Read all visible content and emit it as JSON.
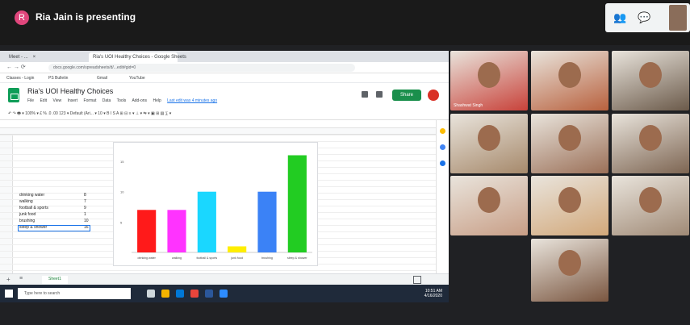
{
  "meet": {
    "presenter_initial": "R",
    "presenting_text": "Ria Jain is presenting",
    "top_right_icons": [
      "people-icon",
      "chat-icon"
    ]
  },
  "browser": {
    "tabs": [
      {
        "label": "Meet - ...",
        "active": false
      },
      {
        "label": "Ria's UOI Healthy Choices - Google Sheets",
        "active": true
      }
    ],
    "url": "docs.google.com/spreadsheets/d/...edit#gid=0",
    "bookmarks": [
      "Classes - Login",
      "PS Bulletin",
      "Gmail",
      "YouTube"
    ]
  },
  "sheet": {
    "title": "Ria's UOI Healthy Choices",
    "menu": [
      "File",
      "Edit",
      "View",
      "Insert",
      "Format",
      "Data",
      "Tools",
      "Add-ons",
      "Help",
      "Last edit was 4 minutes ago"
    ],
    "share_label": "Share",
    "toolbar_text": "↶ ↷ 🖶 ▾ 100% ▾ £ % .0 .00 123 ▾ Default (Ari... ▾ 10 ▾ B I S A ⊞ ⊟ ≡ ▾ ⊥ ▾ ⇆ ▾ ▣ ⊞ ▤ ∑ ▾",
    "sheet_tab_label": "Sheet1",
    "rows": [
      {
        "label": "drinking water",
        "value": "8"
      },
      {
        "label": "walking",
        "value": "7"
      },
      {
        "label": "football & sports",
        "value": "9"
      },
      {
        "label": "junk food",
        "value": "1"
      },
      {
        "label": "brushing",
        "value": "10"
      },
      {
        "label": "sleep & shower",
        "value": "16"
      }
    ]
  },
  "chart_data": {
    "type": "bar",
    "categories": [
      "drinking water",
      "walking",
      "football & sports",
      "junk food",
      "brushing",
      "sleep & shower"
    ],
    "values": [
      7,
      7,
      10,
      1,
      10,
      16
    ],
    "colors": [
      "#ff1a1a",
      "#ff33ff",
      "#1ad7ff",
      "#ffee00",
      "#3b82f6",
      "#22cc22"
    ],
    "ylim": [
      0,
      17
    ],
    "y_ticks": [
      "15",
      "10",
      "5"
    ],
    "grid": false
  },
  "taskbar": {
    "search_placeholder": "Type here to search",
    "time": "10:51 AM",
    "date": "4/16/2020"
  },
  "participants": [
    {
      "name": "Shashwat Singh",
      "color": "#c8423a"
    },
    {
      "name": "",
      "color": "#b8613e"
    },
    {
      "name": "",
      "color": "#6b5a4a"
    },
    {
      "name": "",
      "color": "#a6896b"
    },
    {
      "name": "",
      "color": "#9b7058"
    },
    {
      "name": "",
      "color": "#7d6552"
    },
    {
      "name": "",
      "color": "#c89e86"
    },
    {
      "name": "",
      "color": "#d2a87a"
    },
    {
      "name": "",
      "color": "#a08a76"
    },
    {
      "name": "",
      "color": "#7a5640"
    }
  ]
}
